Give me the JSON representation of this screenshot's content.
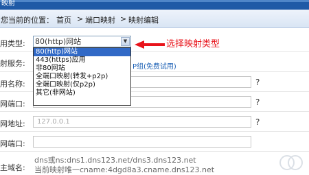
{
  "header": {
    "title_fragment": "映射"
  },
  "breadcrumb": {
    "location_label": "您当前的位置：",
    "home": "首页",
    "sep": ">",
    "port_mapping": "端口映射",
    "mapping_edit": "映射编辑"
  },
  "form": {
    "type_label": "用类型:",
    "type_selected": "80(http)网站",
    "service_label": "射服务:",
    "service_link_fragment": "P组(免费试用)",
    "name_label": "用名称:",
    "inner_port_label": "网端口:",
    "inner_addr_label": "网地址:",
    "inner_addr_value": "127.0.0.1",
    "outer_port_label": "网端口:",
    "domain_label": "主域名:",
    "help_glyph": "?"
  },
  "dropdown": {
    "options": [
      "80(http)网站",
      "443(https)应用",
      "非80网站",
      "全端口映射(转发+p2p)",
      "全端口映射(仅p2p)",
      "其它(非网站)"
    ],
    "selected_index": 0
  },
  "annotation": {
    "text": "选择映射类型",
    "color": "#e8141b"
  },
  "notes": {
    "line1": "dns或ns:dns1.dns123.net/dns3.dns123.net",
    "line2": "当前映射唯一cname:4dgd8a3.cname.dns123.net"
  },
  "icons": {
    "dropdown_arrow": "chevron-down-icon",
    "annotation": "red-arrow-icon",
    "help": "question-mark-icon"
  }
}
